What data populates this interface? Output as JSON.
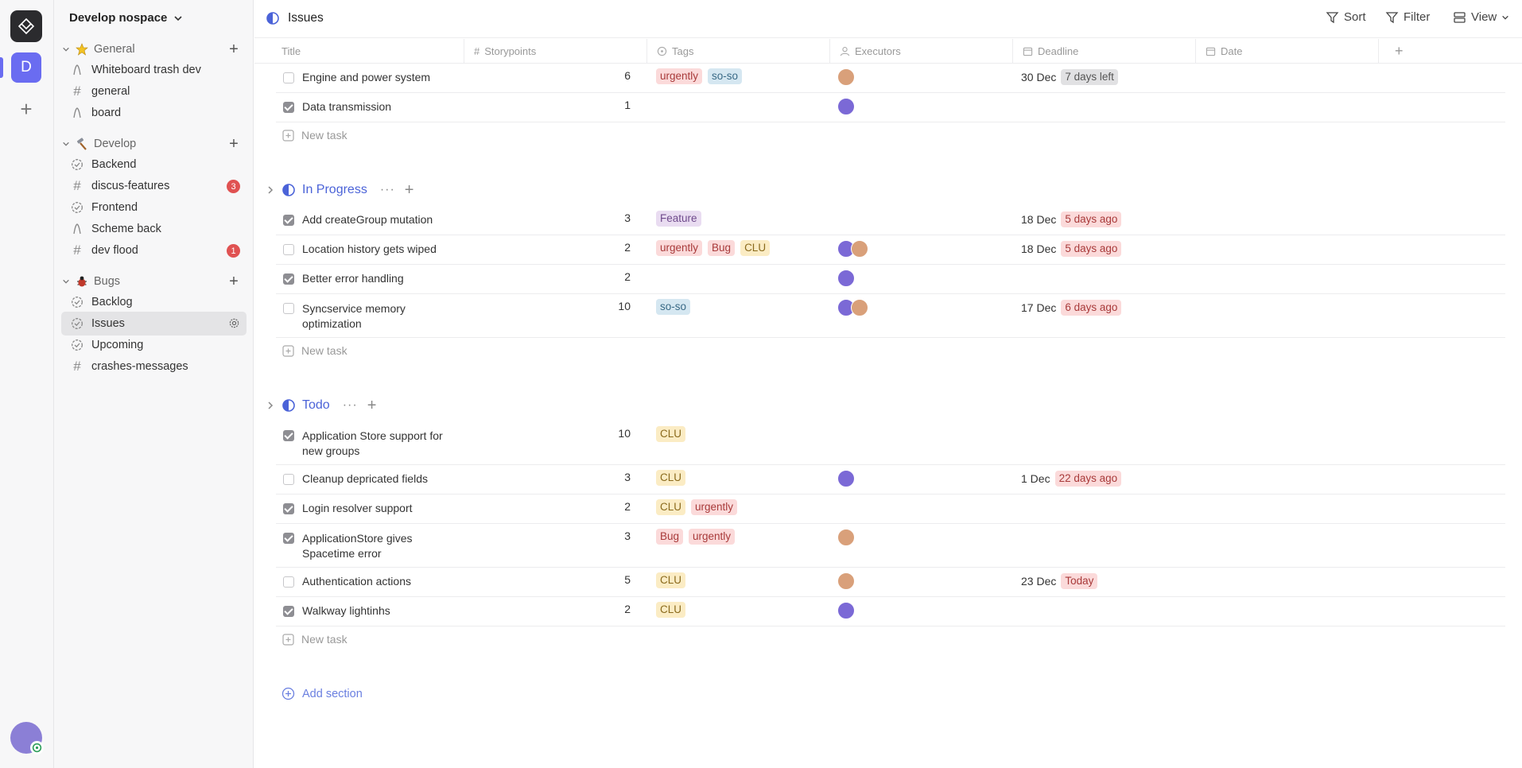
{
  "workspace": {
    "initial": "D",
    "name": "Develop nospace"
  },
  "sidebar": {
    "sections": [
      {
        "label": "General",
        "items": [
          {
            "label": "Whiteboard trash dev",
            "icon": "whiteboard-icon"
          },
          {
            "label": "general",
            "icon": "hash-icon"
          },
          {
            "label": "board",
            "icon": "whiteboard-icon"
          }
        ]
      },
      {
        "label": "Develop",
        "items": [
          {
            "label": "Backend",
            "icon": "tasks-icon"
          },
          {
            "label": "discus-features",
            "icon": "hash-icon",
            "badge": "3"
          },
          {
            "label": "Frontend",
            "icon": "tasks-icon"
          },
          {
            "label": "Scheme back",
            "icon": "whiteboard-icon"
          },
          {
            "label": "dev flood",
            "icon": "hash-icon",
            "badge": "1"
          }
        ]
      },
      {
        "label": "Bugs",
        "items": [
          {
            "label": "Backlog",
            "icon": "tasks-icon"
          },
          {
            "label": "Issues",
            "icon": "tasks-icon",
            "active": true
          },
          {
            "label": "Upcoming",
            "icon": "tasks-icon"
          },
          {
            "label": "crashes-messages",
            "icon": "hash-icon"
          }
        ]
      }
    ]
  },
  "header": {
    "title": "Issues",
    "sort": "Sort",
    "filter": "Filter",
    "view": "View"
  },
  "columns": {
    "title": "Title",
    "storypoints": "Storypoints",
    "tags": "Tags",
    "executors": "Executors",
    "deadline": "Deadline",
    "date": "Date"
  },
  "groups": {
    "first": {
      "tasks": [
        {
          "title": "Engine and power system",
          "done": false,
          "sp": "6",
          "tags": [
            "urgently",
            "so-so"
          ],
          "ex": [
            "b"
          ],
          "dl": "30 Dec",
          "rel": "7 days left",
          "relKind": "grey"
        },
        {
          "title": "Data transmission",
          "done": true,
          "sp": "1",
          "tags": [],
          "ex": [
            "a"
          ],
          "dl": "",
          "rel": ""
        }
      ]
    },
    "inprogress": {
      "label": "In Progress",
      "tasks": [
        {
          "title": "Add createGroup mutation",
          "done": true,
          "sp": "3",
          "tags": [
            "Feature"
          ],
          "ex": [],
          "dl": "18 Dec",
          "rel": "5 days ago",
          "relKind": "red"
        },
        {
          "title": "Location history gets wiped",
          "done": false,
          "sp": "2",
          "tags": [
            "urgently",
            "Bug",
            "CLU"
          ],
          "ex": [
            "a",
            "b"
          ],
          "dl": "18 Dec",
          "rel": "5 days ago",
          "relKind": "red"
        },
        {
          "title": "Better error handling",
          "done": true,
          "sp": "2",
          "tags": [],
          "ex": [
            "a"
          ],
          "dl": "",
          "rel": ""
        },
        {
          "title": "Syncservice memory optimization",
          "done": false,
          "sp": "10",
          "tags": [
            "so-so"
          ],
          "ex": [
            "a",
            "b"
          ],
          "dl": "17 Dec",
          "rel": "6 days ago",
          "relKind": "red"
        }
      ]
    },
    "todo": {
      "label": "Todo",
      "tasks": [
        {
          "title": "Application Store support for new groups",
          "done": true,
          "sp": "10",
          "tags": [
            "CLU"
          ],
          "ex": [],
          "dl": "",
          "rel": ""
        },
        {
          "title": "Cleanup depricated fields",
          "done": false,
          "sp": "3",
          "tags": [
            "CLU"
          ],
          "ex": [
            "a"
          ],
          "dl": "1 Dec",
          "rel": "22 days ago",
          "relKind": "red"
        },
        {
          "title": "Login resolver support",
          "done": true,
          "sp": "2",
          "tags": [
            "CLU",
            "urgently"
          ],
          "ex": [],
          "dl": "",
          "rel": ""
        },
        {
          "title": "ApplicationStore gives Spacetime error",
          "done": true,
          "sp": "3",
          "tags": [
            "Bug",
            "urgently"
          ],
          "ex": [
            "b"
          ],
          "dl": "",
          "rel": ""
        },
        {
          "title": "Authentication actions",
          "done": false,
          "sp": "5",
          "tags": [
            "CLU"
          ],
          "ex": [
            "b"
          ],
          "dl": "23 Dec",
          "rel": "Today",
          "relKind": "red"
        },
        {
          "title": "Walkway lightinhs",
          "done": true,
          "sp": "2",
          "tags": [
            "CLU"
          ],
          "ex": [
            "a"
          ],
          "dl": "",
          "rel": ""
        }
      ]
    }
  },
  "new_task": "New task",
  "add_section": "Add section",
  "tag_colors": {
    "urgently": {
      "bg": "#fbdada",
      "fg": "#a83a3a"
    },
    "so-so": {
      "bg": "#d5e7f1",
      "fg": "#3a6a86"
    },
    "Feature": {
      "bg": "#e9dcf1",
      "fg": "#6f4a8c"
    },
    "Bug": {
      "bg": "#fbdada",
      "fg": "#a83a3a"
    },
    "CLU": {
      "bg": "#fbecc4",
      "fg": "#8a6a1c"
    }
  },
  "rel_colors": {
    "grey": {
      "bg": "#e1e1e3",
      "fg": "#555555"
    },
    "red": {
      "bg": "#fbdada",
      "fg": "#a83a3a"
    }
  }
}
